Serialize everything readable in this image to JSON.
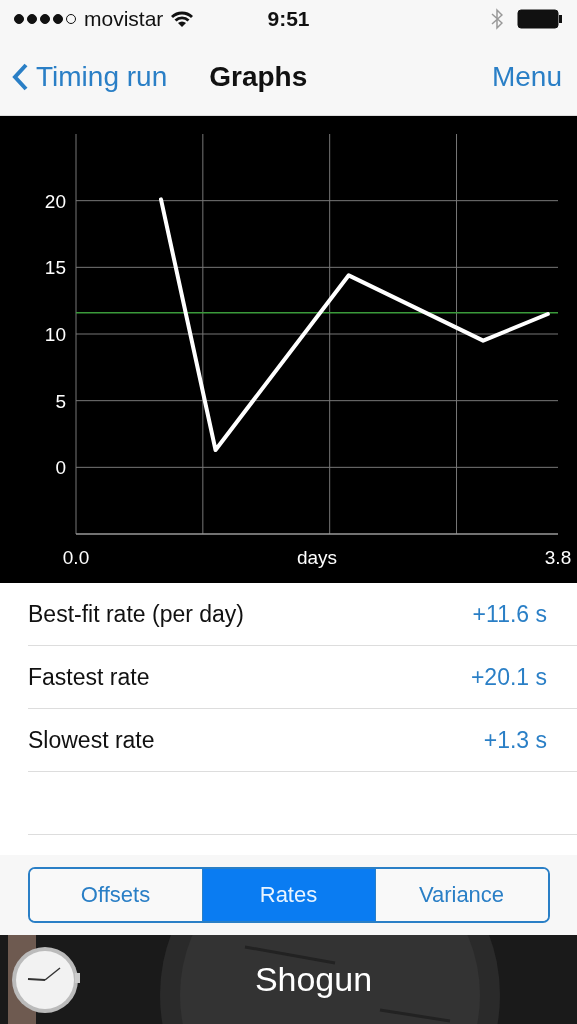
{
  "status_bar": {
    "signal_dots": [
      {
        "filled": true
      },
      {
        "filled": true
      },
      {
        "filled": true
      },
      {
        "filled": true
      },
      {
        "filled": false
      }
    ],
    "carrier": "movistar",
    "time": "9:51"
  },
  "nav": {
    "back": "Timing run",
    "title": "Graphs",
    "menu": "Menu"
  },
  "graph": {
    "chart_data": {
      "type": "line",
      "xlabel": "days",
      "x": [
        0.67,
        1.1,
        2.15,
        3.21,
        3.72
      ],
      "series": [
        {
          "color": "#ffffff",
          "values": [
            20.1,
            1.3,
            14.4,
            9.5,
            11.5
          ]
        }
      ],
      "xlim": [
        0,
        3.8
      ],
      "ylim": [
        -5,
        25
      ],
      "xticks": [
        {
          "value": 0,
          "label": "0.0"
        },
        {
          "value": 3.8,
          "label": "3.8"
        }
      ],
      "yticks": [
        0,
        5,
        10,
        15,
        20
      ],
      "grid": true,
      "ref_lines": [
        {
          "axis": "y",
          "value": 11.6,
          "color": "#3a9a3a"
        }
      ]
    }
  },
  "stats": [
    {
      "label": "Best-fit rate (per day)",
      "value": "+11.6 s"
    },
    {
      "label": "Fastest rate",
      "value": "+20.1 s"
    },
    {
      "label": "Slowest rate",
      "value": "+1.3 s"
    }
  ],
  "segments": [
    {
      "label": "Offsets",
      "selected": false
    },
    {
      "label": "Rates",
      "selected": true
    },
    {
      "label": "Variance",
      "selected": false
    }
  ],
  "banner": {
    "kind": "picture",
    "name": "Shogun"
  }
}
